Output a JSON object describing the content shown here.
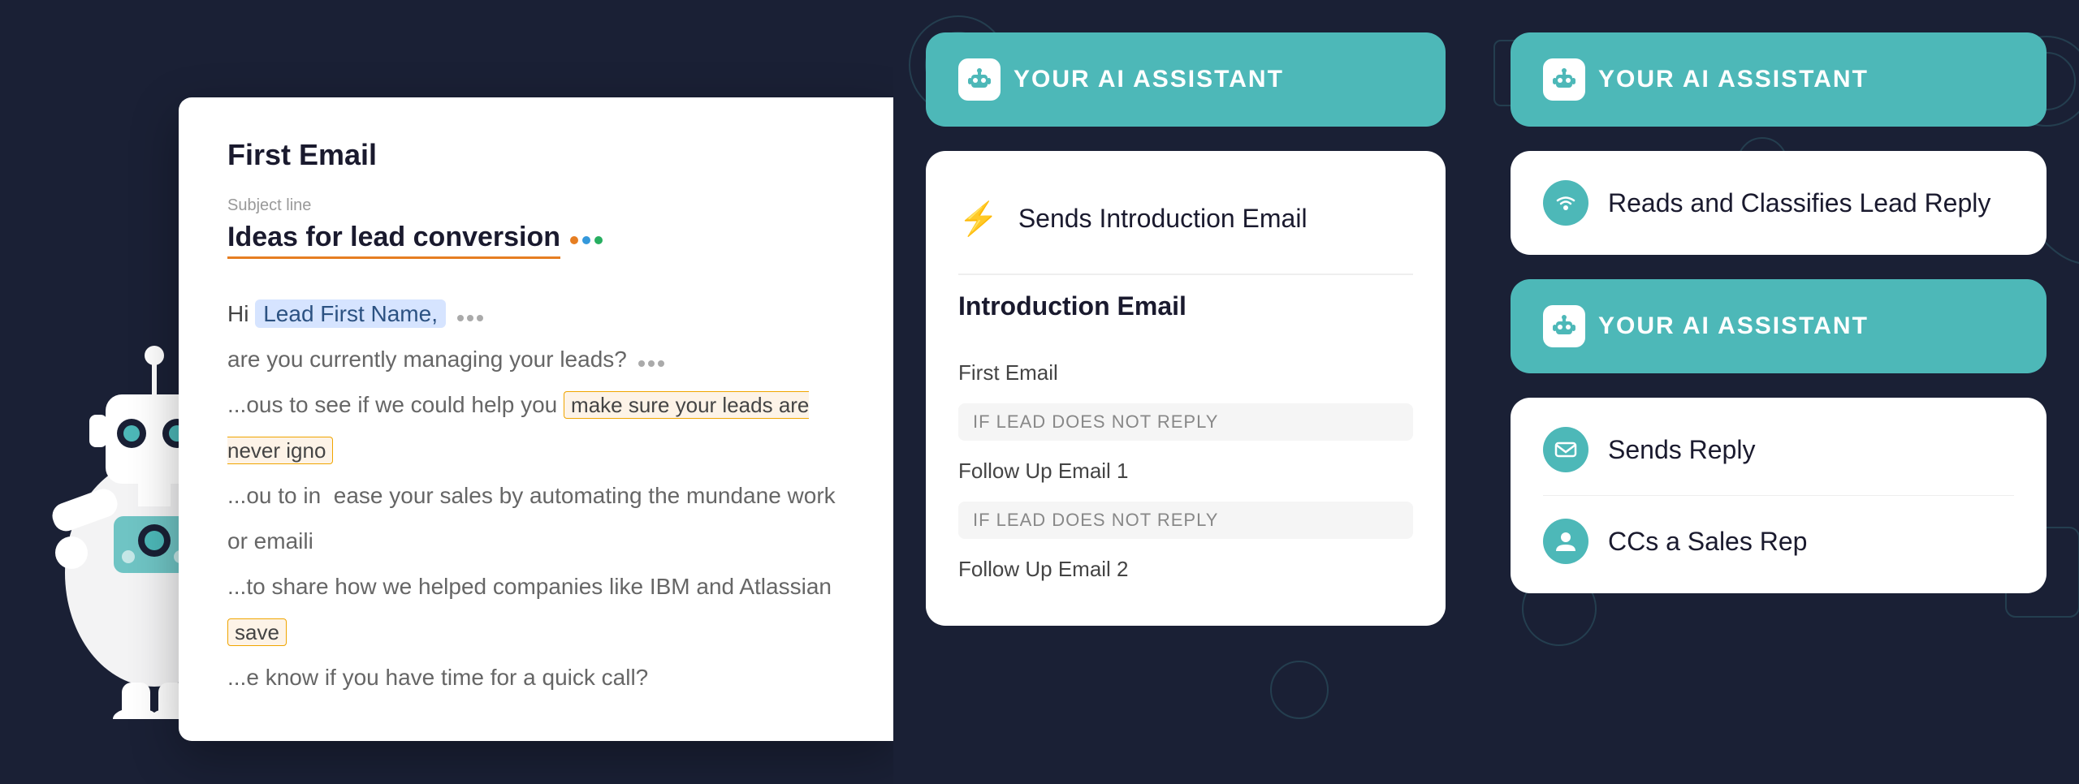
{
  "left": {
    "email_card": {
      "title": "First Email",
      "subject_label": "Subject line",
      "subject_text": "Ideas for lead conversion",
      "body_lines": [
        "Hi [Lead First Name], •••",
        "are you currently managing your leads? •••",
        "ous to see if we could help you  make sure your leads are never igno",
        "ou to in  ease your sales by automating the mundane work or emaili",
        "to share how we helped companies like IBM and Atlassian  save",
        "e know if you have time for a quick call?"
      ]
    }
  },
  "center": {
    "ai_card": {
      "title": "YOUR AI ASSISTANT",
      "action": "Sends Introduction Email"
    },
    "intro_email": {
      "title": "Introduction Email",
      "steps": [
        "First Email",
        "IF LEAD DOES NOT REPLY",
        "Follow Up Email 1",
        "IF LEAD DOES NOT REPLY",
        "Follow Up Email 2"
      ]
    }
  },
  "right": {
    "ai_card_1": {
      "title": "YOUR AI ASSISTANT",
      "action": "Reads and Classifies Lead Reply"
    },
    "ai_card_2": {
      "title": "YOUR AI ASSISTANT",
      "actions": [
        {
          "label": "Sends Reply",
          "icon": "email"
        },
        {
          "label": "CCs a Sales Rep",
          "icon": "person"
        }
      ]
    }
  },
  "icons": {
    "robot": "🤖",
    "email": "✉",
    "person": "👤",
    "lightning": "⚡",
    "wifi": "((·))"
  }
}
